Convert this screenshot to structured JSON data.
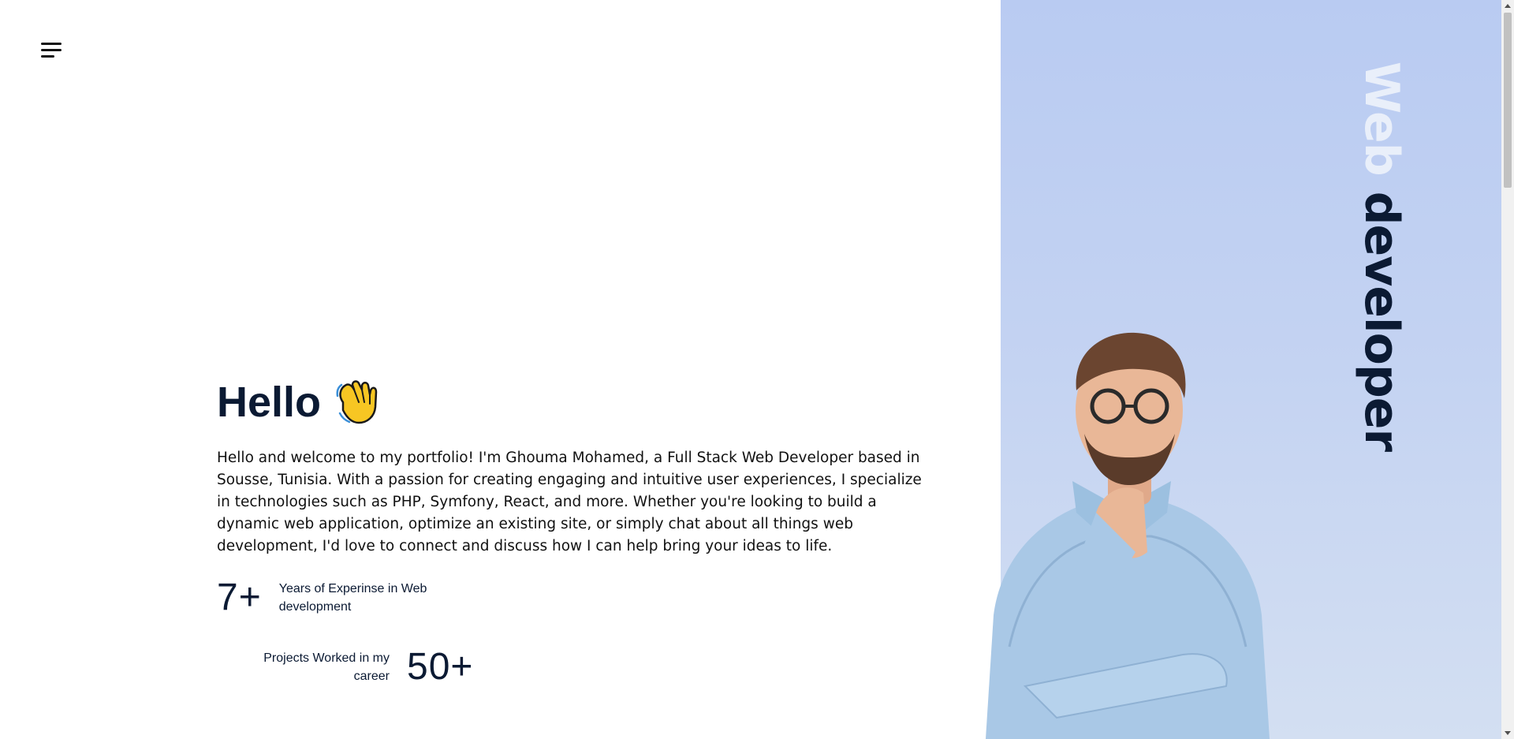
{
  "nav": {
    "menu_icon": "hamburger-menu-icon"
  },
  "hero": {
    "greeting": "Hello",
    "greeting_icon": "waving-hand-icon",
    "bio": "Hello and welcome to my portfolio! I'm Ghouma Mohamed, a Full Stack Web Developer based in Sousse, Tunisia. With a passion for creating engaging and intuitive user experiences, I specialize in technologies such as PHP, Symfony, React, and more. Whether you're looking to build a dynamic web application, optimize an existing site, or simply chat about all things web development, I'd love to connect and discuss how I can help bring your ideas to life."
  },
  "stats": [
    {
      "value": "7+",
      "label": "Years of Experinse in Web development"
    },
    {
      "value": "50+",
      "label": "Projects Worked in my career"
    }
  ],
  "side": {
    "title_word1": "Web",
    "title_word2": "developer",
    "background_top": "#b9cbf2",
    "background_bottom": "#d3dff2"
  },
  "colors": {
    "text_dark": "#0b1a33",
    "accent_light": "#e9effa"
  }
}
